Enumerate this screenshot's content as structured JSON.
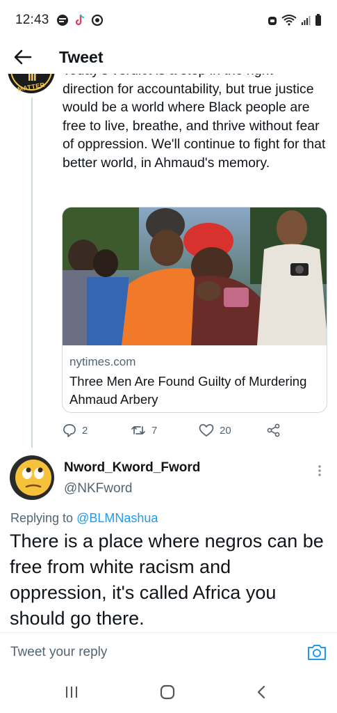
{
  "status_bar": {
    "time": "12:43",
    "left_icons": [
      "chat-bubble-icon",
      "tiktok-icon",
      "circle-badge-icon"
    ],
    "right_icons": [
      "alarm-icon",
      "wifi-icon",
      "signal-icon",
      "battery-icon"
    ]
  },
  "header": {
    "title": "Tweet",
    "back_icon": "back-arrow-icon"
  },
  "parent_tweet": {
    "avatar_text": "MATTER",
    "text": "Today's verdict is a step in the right direction for accountability, but true justice would be a world where Black people are free to live, breathe, and thrive without fear of oppression. We'll continue to fight for that better world, in Ahmaud's memory.",
    "card": {
      "domain": "nytimes.com",
      "title": "Three Men Are Found Guilty of Murdering Ahmaud Arbery"
    },
    "actions": {
      "replies": "2",
      "retweets": "7",
      "likes": "20"
    }
  },
  "reply_tweet": {
    "display_name": "Nword_Kword_Fword",
    "handle": "@NKFword",
    "replying_to_label": "Replying to",
    "replying_to_user": "@BLMNashua",
    "text": "There is a place where negros can be free from white racism and oppression, it's called Africa you should go there."
  },
  "composer": {
    "placeholder": "Tweet your reply"
  },
  "colors": {
    "accent": "#1d9bf0",
    "secondary_text": "#536471",
    "divider": "#cfd9de"
  }
}
